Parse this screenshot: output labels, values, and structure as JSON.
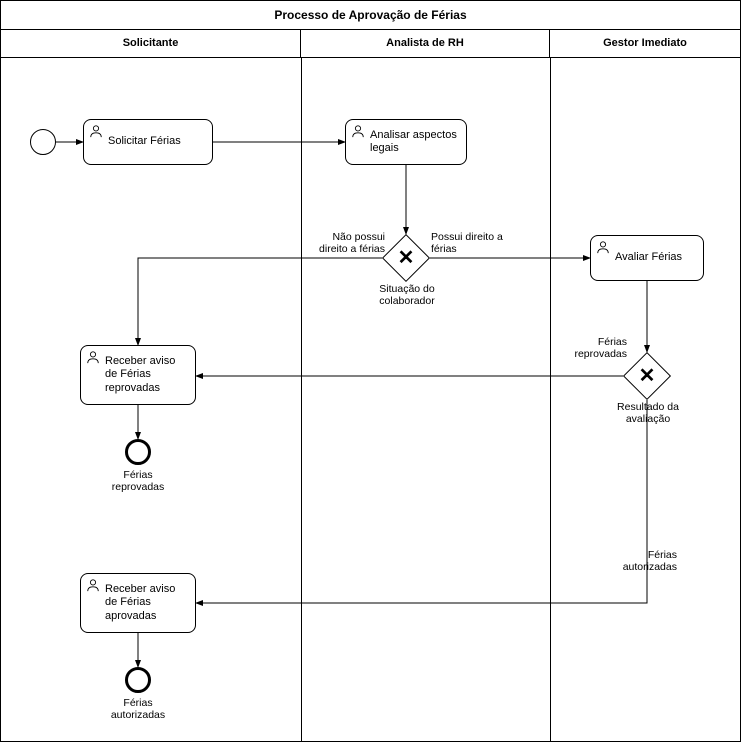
{
  "pool": {
    "title": "Processo de Aprovação de Férias",
    "lanes": [
      "Solicitante",
      "Analista de RH",
      "Gestor Imediato"
    ]
  },
  "tasks": {
    "solicitar_ferias": "Solicitar Férias",
    "analisar_aspectos": "Analisar aspectos legais",
    "avaliar_ferias": "Avaliar Férias",
    "receber_reprovadas": "Receber aviso de Férias reprovadas",
    "receber_aprovadas": "Receber aviso de Férias aprovadas"
  },
  "gateways": {
    "situacao": "Situação do colaborador",
    "resultado": "Resultado da avaliação"
  },
  "flow_labels": {
    "nao_possui": "Não possui direito a férias",
    "possui": "Possui direito a férias",
    "reprovadas": "Férias reprovadas",
    "autorizadas_flow": "Férias autorizadas"
  },
  "end_events": {
    "reprovadas": "Férias reprovadas",
    "autorizadas": "Férias autorizadas"
  }
}
